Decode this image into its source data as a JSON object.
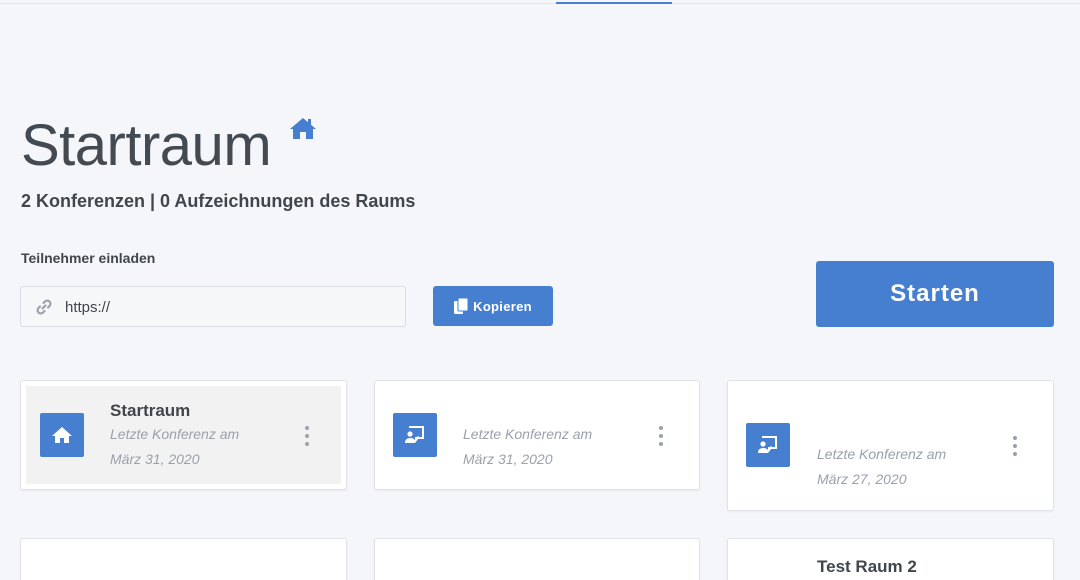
{
  "room": {
    "title": "Startraum",
    "stats": "2 Konferenzen | 0 Aufzeichnungen des Raums"
  },
  "invite": {
    "label": "Teilnehmer einladen",
    "url_value": "https://",
    "copy_label": "Kopieren"
  },
  "start": {
    "label": "Starten"
  },
  "cards": [
    {
      "name": "Startraum",
      "meta_line1": "Letzte Konferenz am",
      "meta_line2": "März 31, 2020",
      "icon": "home-icon"
    },
    {
      "name": "",
      "meta_line1": "Letzte Konferenz am",
      "meta_line2": "März 31, 2020",
      "icon": "presentation-icon"
    },
    {
      "name": "",
      "meta_line1": "Letzte Konferenz am",
      "meta_line2": "März 27, 2020",
      "icon": "presentation-icon"
    },
    {
      "name": "",
      "meta_line1": "",
      "meta_line2": "",
      "icon": ""
    },
    {
      "name": "",
      "meta_line1": "",
      "meta_line2": "",
      "icon": ""
    },
    {
      "name": "Test Raum 2",
      "meta_line1": "",
      "meta_line2": "",
      "icon": ""
    }
  ],
  "colors": {
    "accent": "#467fcf",
    "background": "#f4f6fa",
    "text": "#41464d",
    "muted": "#9aa0ac"
  }
}
